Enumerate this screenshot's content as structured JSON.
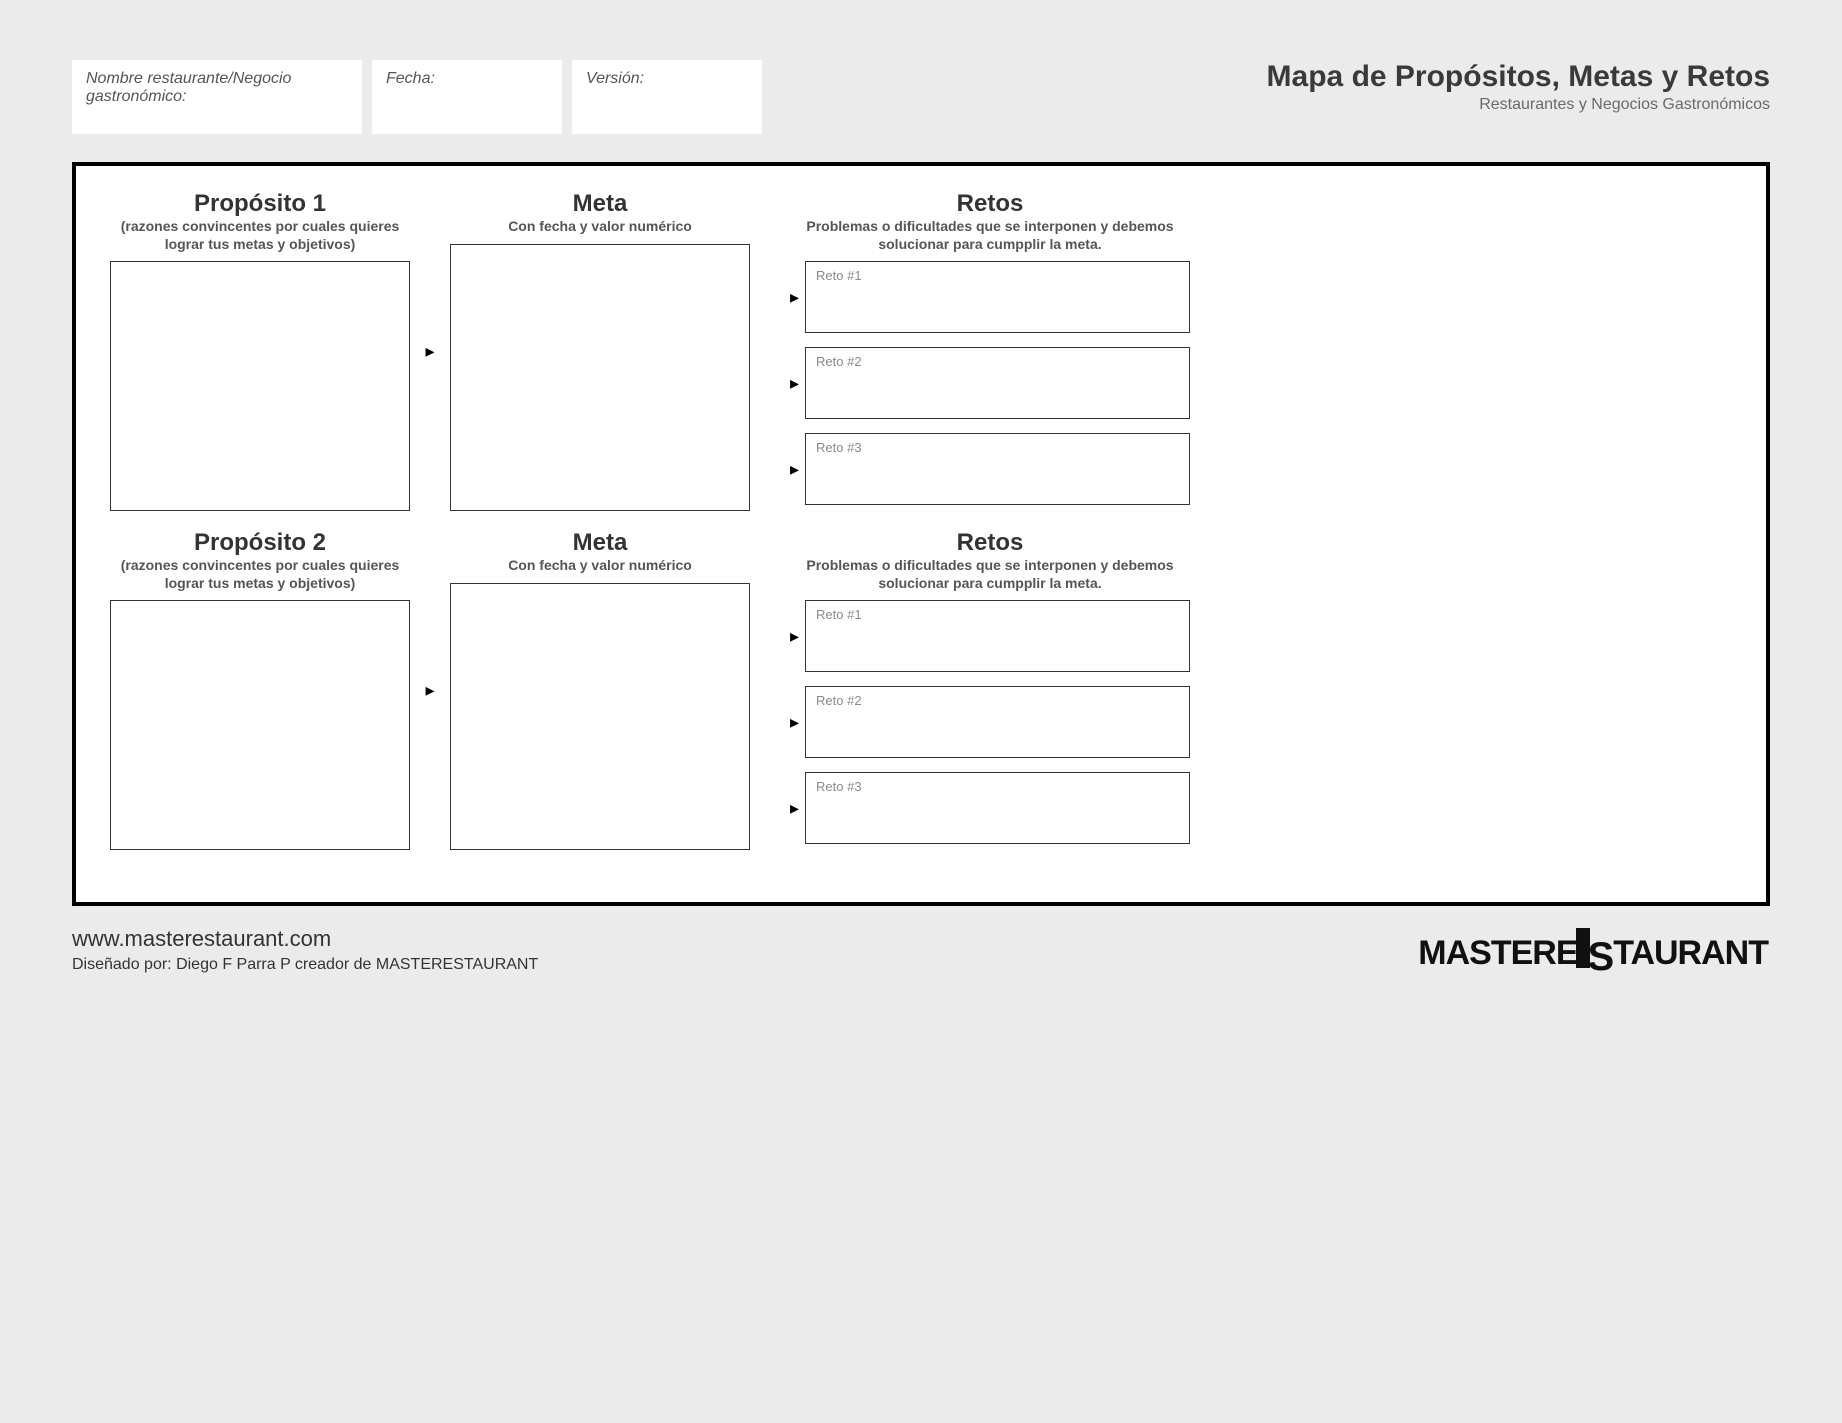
{
  "header": {
    "fields": {
      "name_label": "Nombre restaurante/Negocio gastronómico:",
      "date_label": "Fecha:",
      "version_label": "Versión:"
    },
    "title": "Mapa de Propósitos, Metas y Retos",
    "subtitle": "Restaurantes y Negocios Gastronómicos"
  },
  "sections": [
    {
      "proposito": {
        "title": "Propósito 1",
        "subtitle": "(razones convincentes por cuales quieres lograr tus metas y objetivos)"
      },
      "meta": {
        "title": "Meta",
        "subtitle": "Con fecha y valor numérico"
      },
      "retos": {
        "title": "Retos",
        "subtitle": "Problemas o dificultades que se interponen y debemos solucionar para cumpplir la meta.",
        "items": [
          "Reto #1",
          "Reto #2",
          "Reto #3"
        ]
      }
    },
    {
      "proposito": {
        "title": "Propósito 2",
        "subtitle": "(razones convincentes por cuales quieres lograr tus metas y objetivos)"
      },
      "meta": {
        "title": "Meta",
        "subtitle": "Con fecha y valor numérico"
      },
      "retos": {
        "title": "Retos",
        "subtitle": "Problemas o dificultades que se interponen y debemos solucionar para cumpplir la meta.",
        "items": [
          "Reto #1",
          "Reto #2",
          "Reto #3"
        ]
      }
    }
  ],
  "footer": {
    "site": "www.masterestaurant.com",
    "credit": "Diseñado por: Diego F Parra P creador de MASTERESTAURANT",
    "logo_pre": "MASTERE",
    "logo_s": "S",
    "logo_post": "TAURANT"
  }
}
